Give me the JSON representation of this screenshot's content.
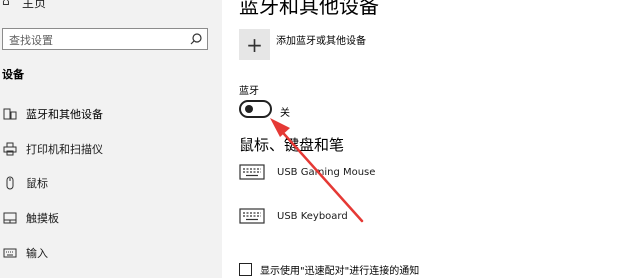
{
  "sidebar": {
    "home_label": "主页",
    "search_placeholder": "查找设置",
    "section_title": "设备",
    "items": [
      {
        "label": "蓝牙和其他设备",
        "icon": "bluetooth-devices-icon"
      },
      {
        "label": "打印机和扫描仪",
        "icon": "printer-icon"
      },
      {
        "label": "鼠标",
        "icon": "mouse-icon"
      },
      {
        "label": "触摸板",
        "icon": "touchpad-icon"
      },
      {
        "label": "输入",
        "icon": "keyboard-icon"
      }
    ]
  },
  "main": {
    "title": "蓝牙和其他设备",
    "add_device_label": "添加蓝牙或其他设备",
    "bluetooth_label": "蓝牙",
    "bluetooth_state": "关",
    "bluetooth_on": false,
    "group_heading": "鼠标、键盘和笔",
    "devices": [
      {
        "name": "USB Gaming Mouse",
        "icon": "keyboard-icon"
      },
      {
        "name": "USB Keyboard",
        "icon": "keyboard-icon"
      }
    ],
    "swift_pair_label": "显示使用\"迅速配对\"进行连接的通知",
    "swift_pair_checked": false
  },
  "colors": {
    "sidebar_bg": "#f2f2f2",
    "annotation_arrow": "#e53935"
  }
}
